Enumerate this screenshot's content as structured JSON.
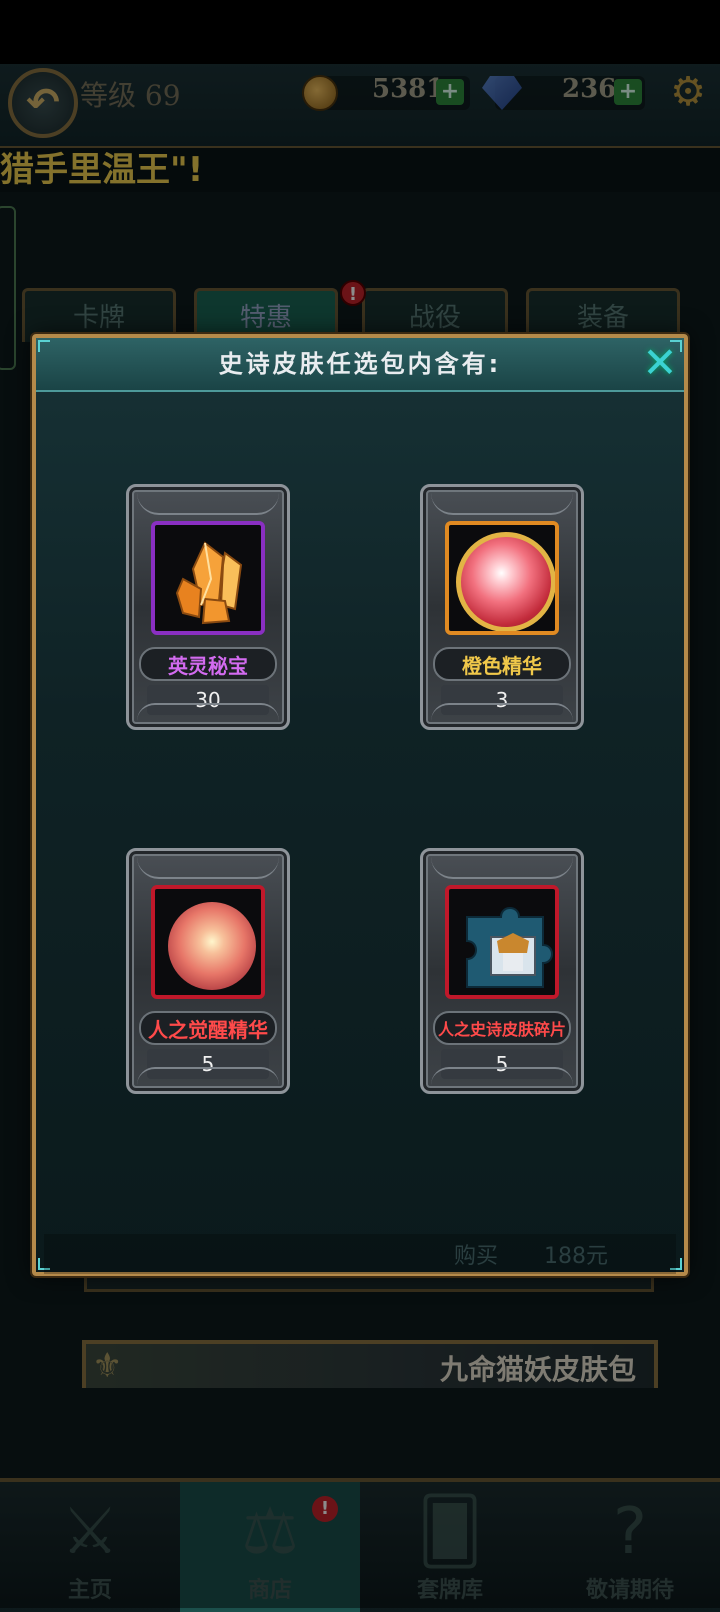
{
  "header": {
    "level_label": "等级 69",
    "coins": "5381",
    "gems": "236",
    "plus_symbol": "+",
    "back_symbol": "↶",
    "gear_symbol": "⚙"
  },
  "marquee": {
    "text": "猎手里温王\"!"
  },
  "tabs": [
    {
      "label": "卡牌"
    },
    {
      "label": "特惠"
    },
    {
      "label": "战役"
    },
    {
      "label": "装备"
    }
  ],
  "badge_symbol": "!",
  "modal": {
    "title": "史诗皮肤任选包内含有:",
    "close_symbol": "✕",
    "footer_buy": "购买",
    "footer_price": "188元",
    "items": [
      {
        "name": "英灵秘宝",
        "qty": "30",
        "name_color": "#d36bf0",
        "frame_color": "#8a2fc2",
        "icon": "orange-crystal-icon"
      },
      {
        "name": "橙色精华",
        "qty": "3",
        "name_color": "#f0c84a",
        "frame_color": "#e08a22",
        "icon": "red-gem-icon"
      },
      {
        "name": "人之觉醒精华",
        "qty": "5",
        "name_color": "#ff4a4a",
        "frame_color": "#c0182a",
        "icon": "essence-orb-icon"
      },
      {
        "name": "人之史诗皮肤碎片",
        "qty": "5",
        "name_color": "#ff4a4a",
        "frame_color": "#c0182a",
        "icon": "skin-fragment-icon"
      }
    ]
  },
  "banner": {
    "text": "九命猫妖皮肤包"
  },
  "bottom_nav": [
    {
      "label": "主页",
      "icon": "⚔"
    },
    {
      "label": "商店",
      "icon": "⚖"
    },
    {
      "label": "套牌库",
      "icon": "🂠"
    },
    {
      "label": "敬请期待",
      "icon": "?"
    }
  ]
}
